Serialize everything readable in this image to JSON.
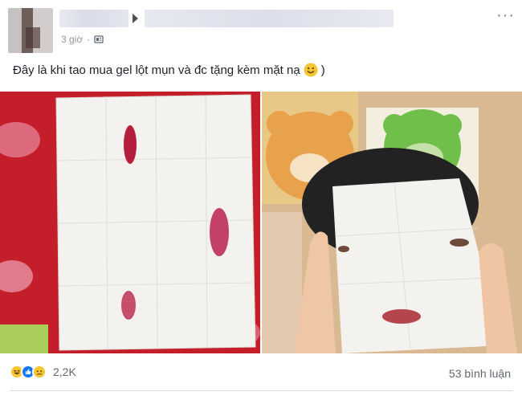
{
  "header": {
    "timestamp": "3 giờ"
  },
  "post": {
    "caption": "Đây là khi tao mua gel lột mụn và đc tặng kèm mặt nạ",
    "caption_suffix": ")"
  },
  "photos": [
    {
      "subject": "sheet-mask-unfolded"
    },
    {
      "subject": "person-wearing-sheet-mask"
    }
  ],
  "footer": {
    "reaction_icons": [
      "haha-icon",
      "like-icon",
      "sad-icon"
    ],
    "reaction_count": "2,2K",
    "comment_count": "53 bình luận"
  },
  "colors": {
    "text": "#1d2129",
    "meta": "#90949c",
    "like_blue": "#1877f2",
    "emoji_yellow": "#f7c531",
    "background": "#ffffff"
  }
}
